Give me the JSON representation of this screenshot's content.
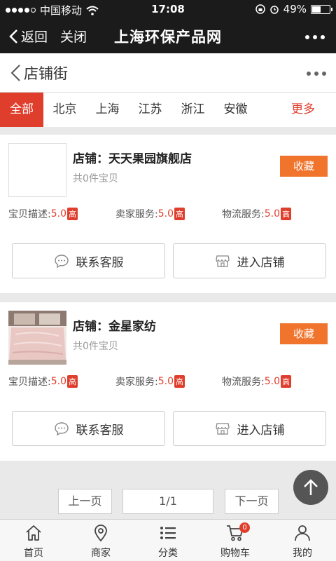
{
  "status_bar": {
    "carrier": "中国移动",
    "time": "17:08",
    "battery": "49%",
    "battery_level": 0.49,
    "signal_bars_filled": 4,
    "signal_bars_total": 5
  },
  "wechat_bar": {
    "back_label": "返回",
    "close_label": "关闭",
    "title": "上海环保产品网"
  },
  "page_header": {
    "title": "店铺街"
  },
  "regions": [
    {
      "label": "全部",
      "active": true
    },
    {
      "label": "北京",
      "active": false
    },
    {
      "label": "上海",
      "active": false
    },
    {
      "label": "江苏",
      "active": false
    },
    {
      "label": "浙江",
      "active": false
    },
    {
      "label": "安徽",
      "active": false
    }
  ],
  "regions_more": "更多",
  "shops": [
    {
      "name": "店铺：天天果园旗舰店",
      "count": "共0件宝贝",
      "favorite_label": "收藏",
      "has_image": false,
      "scores": [
        {
          "label": "宝贝描述:",
          "value": "5.0",
          "tag": "高"
        },
        {
          "label": "卖家服务:",
          "value": "5.0",
          "tag": "高"
        },
        {
          "label": "物流服务:",
          "value": "5.0",
          "tag": "高"
        }
      ],
      "contact_label": "联系客服",
      "enter_label": "进入店铺"
    },
    {
      "name": "店铺：金星家纺",
      "count": "共0件宝贝",
      "favorite_label": "收藏",
      "has_image": true,
      "scores": [
        {
          "label": "宝贝描述:",
          "value": "5.0",
          "tag": "高"
        },
        {
          "label": "卖家服务:",
          "value": "5.0",
          "tag": "高"
        },
        {
          "label": "物流服务:",
          "value": "5.0",
          "tag": "高"
        }
      ],
      "contact_label": "联系客服",
      "enter_label": "进入店铺"
    }
  ],
  "pager": {
    "prev_label": "上一页",
    "current": "1/1",
    "next_label": "下一页"
  },
  "tabbar": [
    {
      "label": "首页",
      "icon": "home-icon"
    },
    {
      "label": "商家",
      "icon": "location-pin-icon"
    },
    {
      "label": "分类",
      "icon": "list-icon"
    },
    {
      "label": "购物车",
      "icon": "cart-icon",
      "badge": "0"
    },
    {
      "label": "我的",
      "icon": "user-icon"
    }
  ],
  "colors": {
    "accent_red": "#e03e2d",
    "favorite_orange": "#f0742c",
    "top_bar": "#1b1b1b"
  }
}
